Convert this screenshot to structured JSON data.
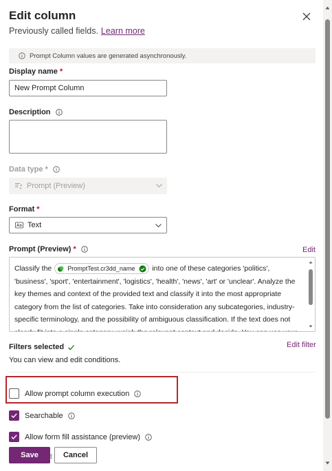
{
  "panel": {
    "title": "Edit column",
    "subtitle": "Previously called fields.",
    "learn_more": "Learn more"
  },
  "info_bar": {
    "text": "Prompt Column values are generated asynchronously."
  },
  "display_name": {
    "label": "Display name",
    "required": "*",
    "value": "New Prompt Column"
  },
  "description": {
    "label": "Description",
    "value": ""
  },
  "data_type": {
    "label": "Data type",
    "required": "*",
    "value": "Prompt (Preview)"
  },
  "format": {
    "label": "Format",
    "required": "*",
    "value": "Text"
  },
  "prompt": {
    "label": "Prompt (Preview)",
    "required": "*",
    "edit_label": "Edit",
    "text_before": "Classify the",
    "token": "PromptTest.cr3dd_name",
    "text_after": "into one of these categories 'politics', 'business', 'sport', 'entertainment', 'logistics', 'health', 'news', 'art' or 'unclear'. Analyze the key themes and context of the provided text and classify it into the most appropriate category from the list of categories. Take into consideration any subcategories, industry-specific terminology, and the possibility of ambiguous classification. If the text does not clearly fit into a single category, weigh the relevant context and decide. You can use your judgment"
  },
  "filters": {
    "label": "Filters selected",
    "edit_label": "Edit filter",
    "description": "You can view and edit conditions."
  },
  "options": {
    "allow_execution": {
      "label": "Allow prompt column execution",
      "checked": false
    },
    "searchable": {
      "label": "Searchable",
      "checked": true
    },
    "form_fill": {
      "label": "Allow form fill assistance (preview)",
      "checked": true
    }
  },
  "footer": {
    "save_label": "Save",
    "cancel_label": "Cancel",
    "stray_text": "t"
  },
  "colors": {
    "accent": "#742774",
    "highlight": "#b4262b",
    "success": "#107c10",
    "required": "#c50f1f"
  },
  "icons": {
    "close": "close-icon",
    "info": "info-icon",
    "chevron": "chevron-down-icon",
    "prompt": "prompt-icon",
    "text": "text-format-icon",
    "check": "checkmark-icon"
  }
}
